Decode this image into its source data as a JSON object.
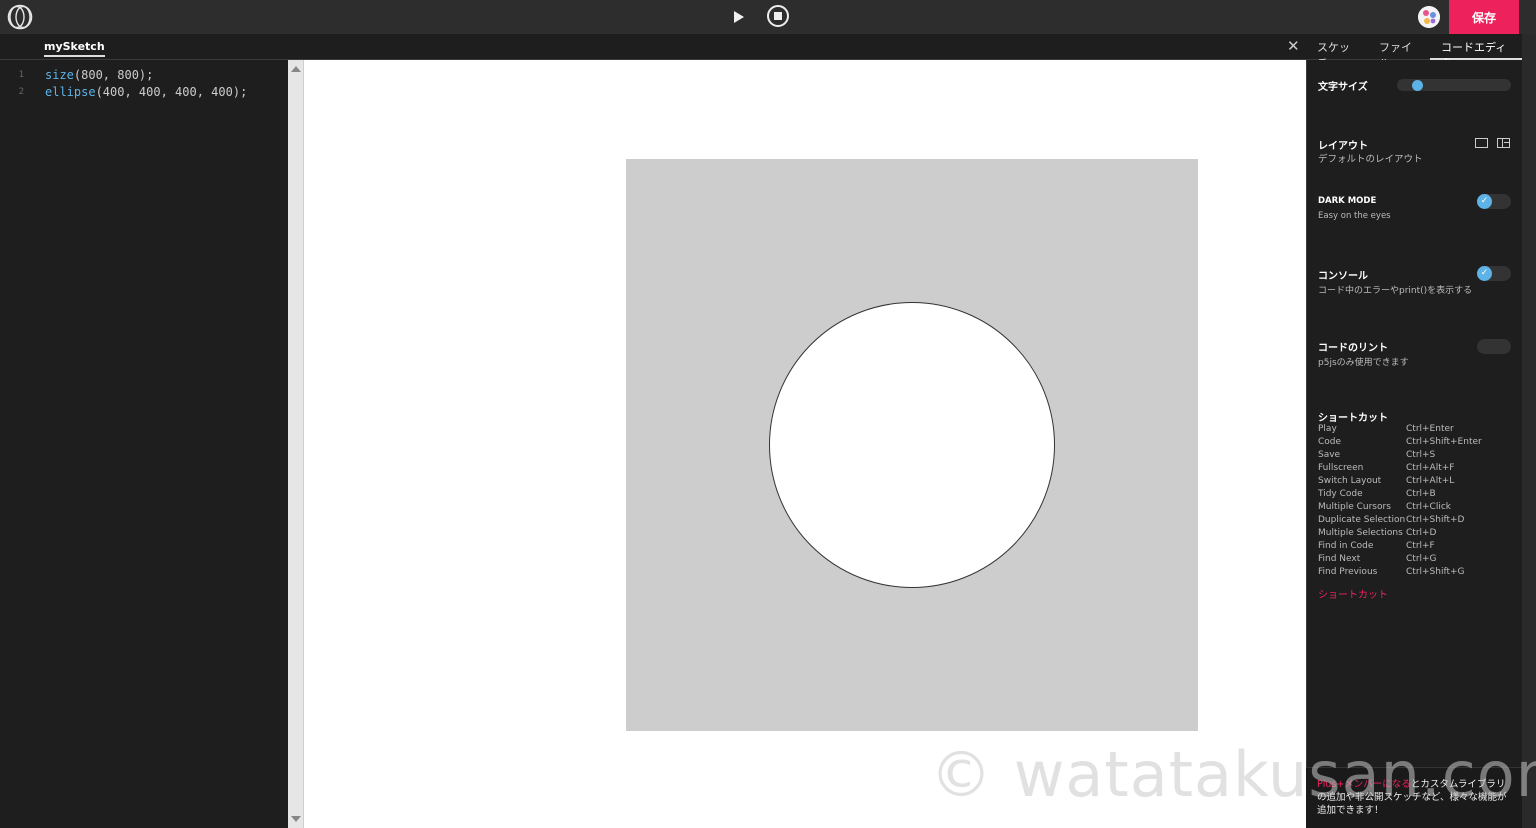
{
  "app": {
    "save_label": "保存",
    "sketch_name": "mySketch"
  },
  "panel_tabs": [
    {
      "label": "スケッチ",
      "active": false
    },
    {
      "label": "ファイル",
      "active": false
    },
    {
      "label": "コードエディタ",
      "active": true
    }
  ],
  "code": {
    "lines": [
      {
        "number": "1",
        "fn": "size",
        "args": "(800, 800);"
      },
      {
        "number": "2",
        "fn": "ellipse",
        "args": "(400, 400, 400, 400);"
      }
    ]
  },
  "settings": {
    "font_size": {
      "title": "文字サイズ",
      "level": 0.15
    },
    "layout": {
      "title": "レイアウト",
      "subtitle": "デフォルトのレイアウト"
    },
    "dark_mode": {
      "title": "DARK MODE",
      "subtitle": "Easy on the eyes",
      "enabled": true
    },
    "console": {
      "title": "コンソール",
      "subtitle": "コード中のエラーやprint()を表示する",
      "enabled": true
    },
    "lint": {
      "title": "コードのリント",
      "subtitle": "p5jsのみ使用できます",
      "enabled": false
    },
    "shortcuts": {
      "title": "ショートカット",
      "link_label": "ショートカット",
      "items": [
        {
          "name": "Play",
          "key": "Ctrl+Enter"
        },
        {
          "name": "Code",
          "key": "Ctrl+Shift+Enter"
        },
        {
          "name": "Save",
          "key": "Ctrl+S"
        },
        {
          "name": "Fullscreen",
          "key": "Ctrl+Alt+F"
        },
        {
          "name": "Switch Layout",
          "key": "Ctrl+Alt+L"
        },
        {
          "name": "Tidy Code",
          "key": "Ctrl+B"
        },
        {
          "name": "Multiple Cursors",
          "key": "Ctrl+Click"
        },
        {
          "name": "Duplicate Selection",
          "key": "Ctrl+Shift+D"
        },
        {
          "name": "Multiple Selections",
          "key": "Ctrl+D"
        },
        {
          "name": "Find in Code",
          "key": "Ctrl+F"
        },
        {
          "name": "Find Next",
          "key": "Ctrl+G"
        },
        {
          "name": "Find Previous",
          "key": "Ctrl+Shift+G"
        }
      ]
    }
  },
  "promo": {
    "highlight": "Plus+メンバーになる",
    "text": "とカスタムライブラリの追加や非公開スケッチなど、様々な機能が追加できます！"
  },
  "watermark": "© watatakusan.com",
  "colors": {
    "accent": "#ed225d",
    "toggle_on": "#5db2e6",
    "canvas_bg": "#cdcdcd"
  }
}
